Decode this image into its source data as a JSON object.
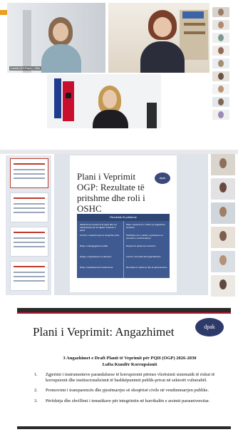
{
  "panel1": {
    "participant_left_name": "Lorela (ILF/Fact) – Slbr",
    "participant_bottom_name": "",
    "thumbnail_accent": "#e8a020"
  },
  "panel2": {
    "slide_title": "Plani i Veprimit OGP: Rezultate të pritshme dhe roli i OSHC",
    "slide_logo": "dpak",
    "table_header": "Rezultate të pritshme",
    "left_column": [
      "Mekanizma monitorimi të qartë dhe më transparente për të ndjekur zbatimin e planit",
      "Forcimi i mekanizmave të shoqërisë civile",
      "Rritje e ndërgjegjësimit publik",
      "Ngritje e kapaciteteve të aktorëve",
      "Rritje e bashkëpunimit institucional"
    ],
    "right_column": [
      "Plani i veprimit të ri i OGP me angazhime konkrete",
      "Përfshirja më e madhe e qytetarëve në procesin e vendimmarrjes",
      "Raporte të pavarura monitorimi",
      "Forcimi i kontrollit dhe llogaridhënies",
      "Rezultate të matshme dhe të qëndrueshme"
    ]
  },
  "panel3": {
    "title": "Plani i Veprimit: Angazhimet",
    "logo": "dpak",
    "heading_line1": "3 Angazhimet e Draft Planit të Veprimit për PQH (OGP) 2026-2030",
    "heading_line2": "Lufta Kundër Korrupsionit",
    "items": [
      {
        "num": "1.",
        "text": "Zgjerimi i instrumenteve parandaluese të korrupsionit përmes vlerësimit sistematik të riskut të korrupsionit dhe institucionalizimit të bashkëpunimit publik-privat në sektorët vulnerabël."
      },
      {
        "num": "2.",
        "text": "Promovimi i transparencës dhe pjesëmarrjes së shoqërisë civile në vendimmarrjen publike."
      },
      {
        "num": "3.",
        "text": "Përfshirja dhe zhvillimi i tematikave për integritetin në kurrikulën e arsimit parauniversitar."
      }
    ]
  },
  "colors": {
    "accent_red": "#b0142a",
    "slide_blue": "#3f5a90",
    "logo_navy": "#2d3a6a"
  }
}
